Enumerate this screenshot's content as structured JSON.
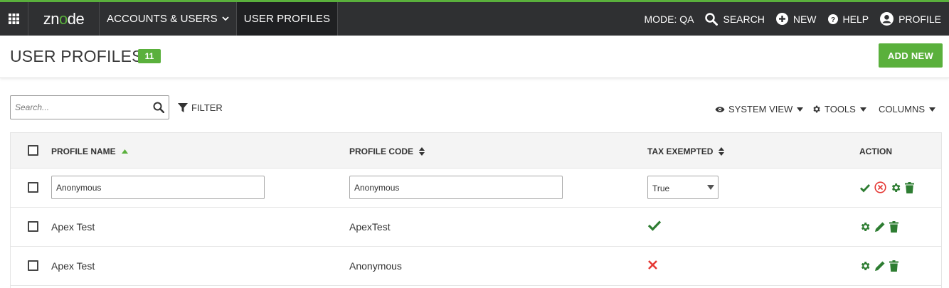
{
  "app": {
    "logo_pre": "zn",
    "logo_mid": "o",
    "logo_post": "de"
  },
  "nav": {
    "accounts": "ACCOUNTS & USERS",
    "profiles": "USER PROFILES"
  },
  "topbar": {
    "mode": "MODE: QA",
    "search": "SEARCH",
    "new": "NEW",
    "help": "HELP",
    "profile": "PROFILE"
  },
  "page": {
    "title": "USER PROFILES",
    "count": "11",
    "add_new": "ADD NEW"
  },
  "toolbar": {
    "search_placeholder": "Search...",
    "filter": "FILTER",
    "system_view": "SYSTEM VIEW",
    "tools": "TOOLS",
    "columns": "COLUMNS"
  },
  "grid": {
    "headers": {
      "profile_name": "PROFILE NAME",
      "profile_code": "PROFILE CODE",
      "tax_exempted": "TAX EXEMPTED",
      "action": "ACTION"
    },
    "edit_row": {
      "profile_name": "Anonymous",
      "profile_code": "Anonymous",
      "tax_exempted": "True"
    },
    "rows": [
      {
        "profile_name": "Apex Test",
        "profile_code": "ApexTest",
        "tax_exempted": "true"
      },
      {
        "profile_name": "Apex Test",
        "profile_code": "Anonymous",
        "tax_exempted": "false"
      }
    ]
  },
  "colors": {
    "accent": "#5ab03c",
    "topbar": "#2f3032",
    "action_green": "#2e7d32",
    "cancel_red": "#e53935"
  },
  "icons": [
    "apps-grid-icon",
    "search-icon",
    "plus-circle-icon",
    "help-icon",
    "user-circle-icon",
    "filter-icon",
    "eye-icon",
    "gear-icon",
    "check-icon",
    "cancel-circle-icon",
    "pencil-icon",
    "trash-icon",
    "x-icon",
    "sort-asc-icon",
    "sort-icon"
  ]
}
